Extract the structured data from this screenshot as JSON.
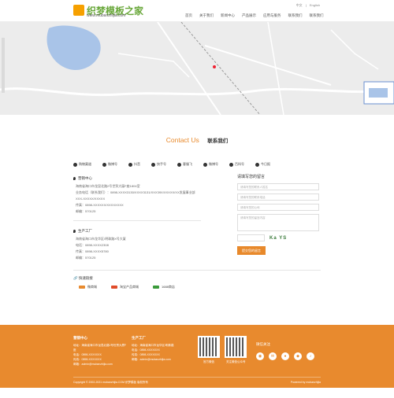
{
  "header": {
    "logo_title": "织梦模板之家",
    "logo_sub": "www.mubanzhijia.com",
    "lang": [
      "中文",
      "English"
    ],
    "nav": [
      "首页",
      "关于我们",
      "新闻中心",
      "产品展示",
      "应用与服务",
      "联系我们",
      "联系我们"
    ]
  },
  "contact": {
    "title_en": "Contact Us",
    "title_cn": "联系我们"
  },
  "social": [
    "购物渠道",
    "微博号",
    "抖音",
    "快手号",
    "客服飞",
    "微博号",
    "百科号",
    "今日报"
  ],
  "sales": {
    "heading": "营销中心",
    "lines": [
      "海南省海口市龙昆北路2号世贸大厦F座1804室",
      "业务电话（联系我们）：0898-XXXX3130/XXXX3131/XXX39X/XXXXX/XX发展事业部",
      "XXX-XXXXX/XXXXX",
      "传真：0898-XXXXXX/XXXXXXXX",
      "邮编：570125"
    ]
  },
  "factory": {
    "heading": "生产工厂",
    "lines": [
      "海南省海口市龙华区/明珠路X号大厦",
      "电话：0898-XXXX2308",
      "传真：0898-XXXX5780",
      "邮编：570125"
    ]
  },
  "form": {
    "title": "请填写您的留言",
    "placeholders": [
      "请填写您的联系人姓名",
      "请填写您的联系电话",
      "请填写您的公司",
      "请填写您的留言内容"
    ],
    "captcha": "Ka YS",
    "submit": "提交您的留言"
  },
  "quick_links": {
    "heading": "快速链接",
    "items": [
      "微商城",
      "淘宝产品商城",
      "1688商店"
    ],
    "colors": [
      "#e88a2e",
      "#e04b2a",
      "#3a9a3a"
    ]
  },
  "footer": {
    "sales_head": "营销中心",
    "sales_lines": [
      "地址：海南省海口市龙昆北路2号世贸大厦F座",
      "电话：0898-XXXXXXX",
      "传真：0898-XXXXXXX",
      "邮箱：admin@mubanzhijia.com"
    ],
    "factory_head": "生产工厂",
    "factory_lines": [
      "地址：海南省海口市龙华区/明珠路",
      "电话：0898-XXXXXXX",
      "传真：0898-XXXXXXX",
      "邮箱：admin@mubanzhijia.com"
    ],
    "qr_caps": [
      "官方微信",
      "关注微信公众号"
    ],
    "follow": "微信关注",
    "copyright": "Copyright © 2002-2021 mubanzhijia.COM 织梦模板 版权所有",
    "powered": "Powered by mubanzhijia",
    "accent": "#e88a2e"
  }
}
